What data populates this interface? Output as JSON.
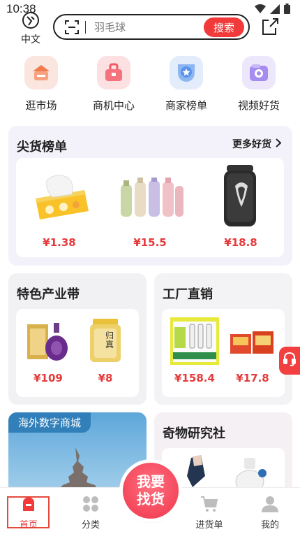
{
  "status": {
    "time": "10:38"
  },
  "header": {
    "lang_label": "中文",
    "search_placeholder": "羽毛球",
    "search_button": "搜索"
  },
  "quick_nav": [
    {
      "label": "逛市场",
      "icon": "market-icon",
      "color": "#fbe5df"
    },
    {
      "label": "商机中心",
      "icon": "briefcase-icon",
      "color": "#fde0e2"
    },
    {
      "label": "商家榜单",
      "icon": "medal-icon",
      "color": "#e2ecfb"
    },
    {
      "label": "视频好货",
      "icon": "video-icon",
      "color": "#ece7fb"
    }
  ],
  "hot_list": {
    "title": "尖货榜单",
    "more": "更多好货",
    "items": [
      {
        "price": "¥1.38",
        "product": "tissue-pack"
      },
      {
        "price": "¥15.5",
        "product": "thermos-set"
      },
      {
        "price": "¥18.8",
        "product": "electric-shaver"
      }
    ]
  },
  "feature": {
    "title": "特色产业带",
    "items": [
      {
        "price": "¥109"
      },
      {
        "price": "¥8",
        "jar_text": "归真"
      }
    ]
  },
  "factory": {
    "title": "工厂直销",
    "items": [
      {
        "price": "¥158.4"
      },
      {
        "price": "¥17.8"
      }
    ]
  },
  "overseas": {
    "title": "海外数字商城"
  },
  "curio": {
    "title": "奇物研究社"
  },
  "fab": {
    "line1": "我要",
    "line2": "找货"
  },
  "bottom_nav": [
    {
      "label": "首页",
      "icon": "home-icon",
      "active": true
    },
    {
      "label": "分类",
      "icon": "category-icon"
    },
    {
      "label": "进货单",
      "icon": "cart-icon"
    },
    {
      "label": "我的",
      "icon": "profile-icon"
    }
  ],
  "colors": {
    "accent": "#f23a3a",
    "price": "#e5393a"
  }
}
